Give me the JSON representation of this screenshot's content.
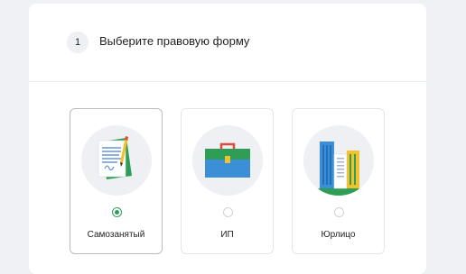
{
  "step": {
    "number": "1",
    "title": "Выберите правовую форму"
  },
  "options": [
    {
      "label": "Самозанятый",
      "selected": true,
      "icon": "document-pen-icon"
    },
    {
      "label": "ИП",
      "selected": false,
      "icon": "briefcase-icon"
    },
    {
      "label": "Юрлицо",
      "selected": false,
      "icon": "office-buildings-icon"
    }
  ],
  "colors": {
    "accent": "#2e9e57",
    "circle_bg": "#eef0f4",
    "page_bg": "#f0f1f4"
  }
}
